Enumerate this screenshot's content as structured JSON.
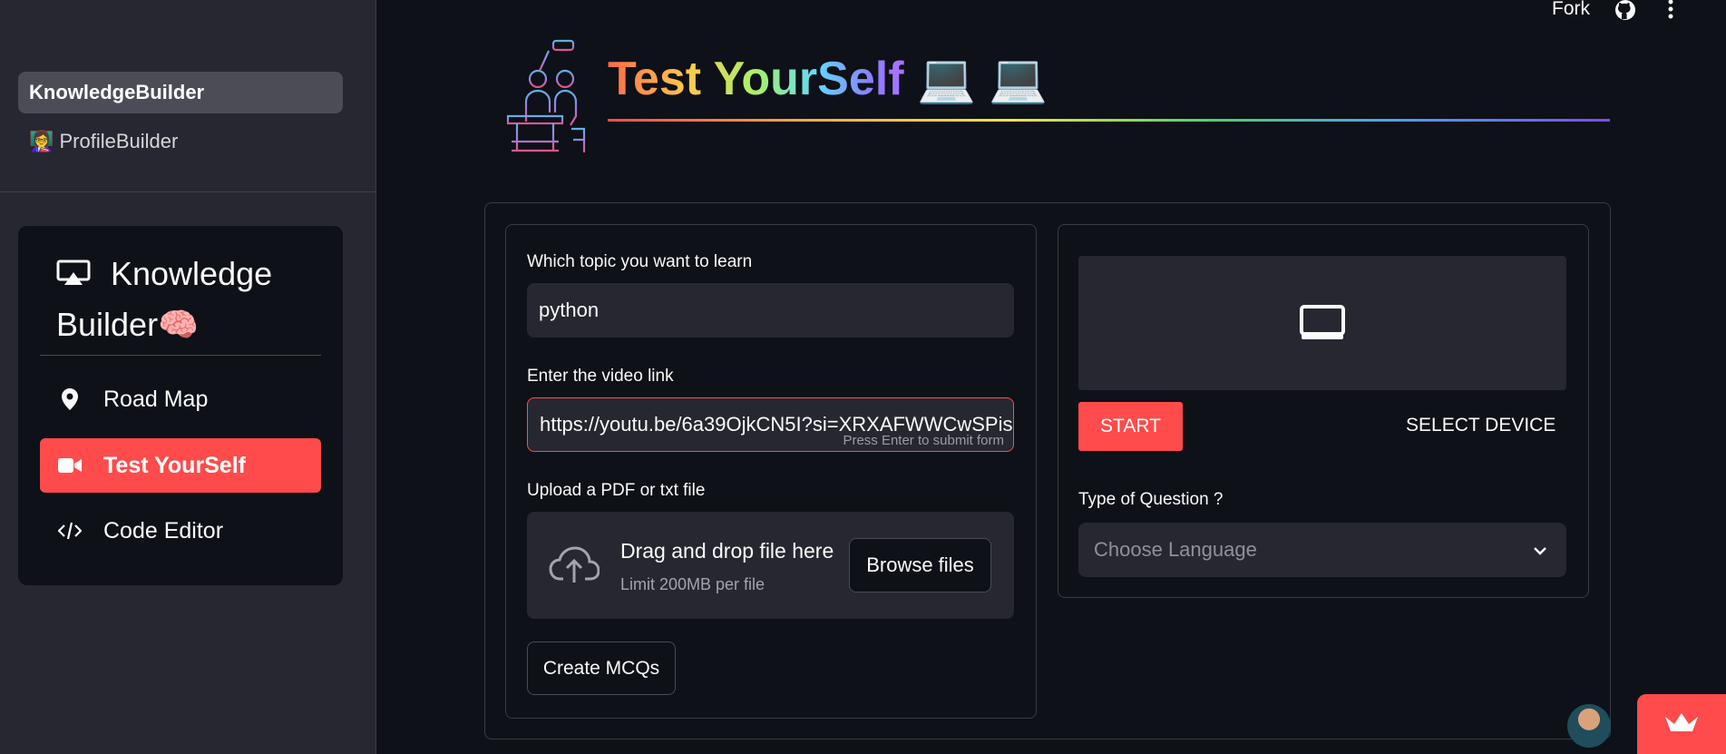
{
  "sidebar": {
    "nav": [
      {
        "label": "KnowledgeBuilder",
        "active": true
      },
      {
        "label": "👩‍🏫 ProfileBuilder",
        "active": false
      }
    ],
    "menu": {
      "title": "Knowledge Builder🧠",
      "items": [
        {
          "label": "Road Map",
          "icon": "map-pin-icon",
          "active": false
        },
        {
          "label": "Test YourSelf",
          "icon": "video-camera-icon",
          "active": true
        },
        {
          "label": "Code Editor",
          "icon": "code-icon",
          "active": false
        }
      ]
    }
  },
  "topbar": {
    "fork_label": "Fork",
    "icons": [
      "github-icon",
      "kebab-menu-icon"
    ]
  },
  "header": {
    "title": "Test YourSelf",
    "title_emoji": "💻 💻"
  },
  "form": {
    "topic": {
      "label": "Which topic you want to learn",
      "value": "python"
    },
    "video": {
      "label": "Enter the video link",
      "value": "https://youtu.be/6a39OjkCN5I?si=XRXAFWWCwSPis",
      "hint": "Press Enter to submit form"
    },
    "upload": {
      "label": "Upload a PDF or txt file",
      "drag_text": "Drag and drop file here",
      "limit_text": "Limit 200MB per file",
      "browse_label": "Browse files"
    },
    "create_button": "Create MCQs"
  },
  "camera": {
    "start_label": "START",
    "select_device_label": "SELECT DEVICE"
  },
  "question": {
    "label": "Type of Question ?",
    "placeholder": "Choose Language"
  },
  "colors": {
    "accent": "#ff4b4b",
    "background": "#0e1117",
    "sidebar": "#262730"
  }
}
